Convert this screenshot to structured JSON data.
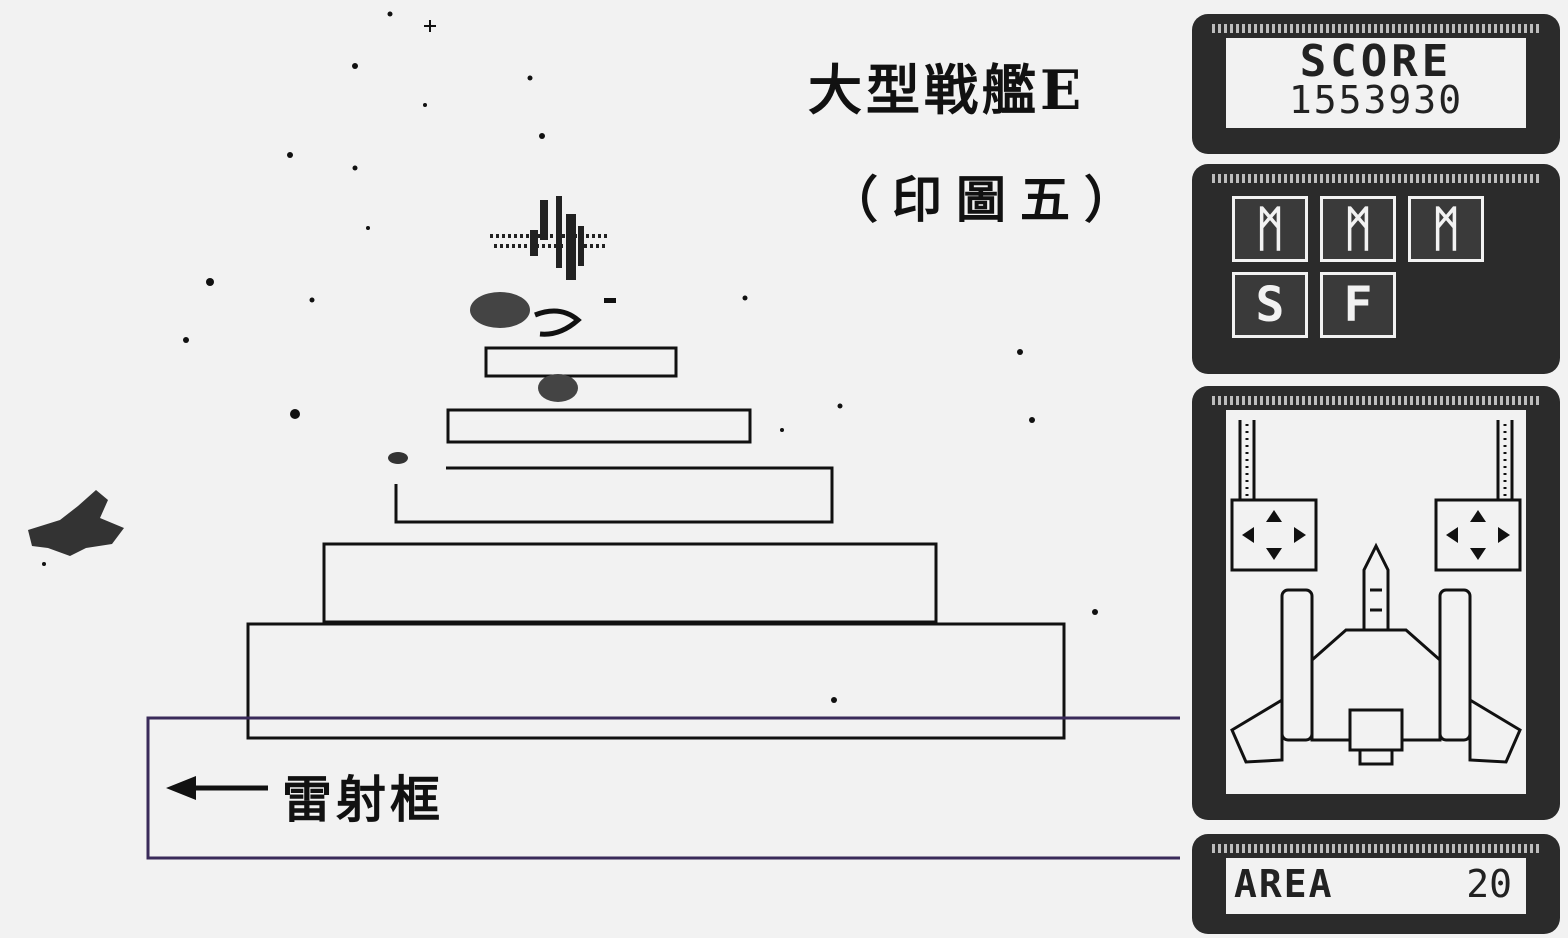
{
  "caption": {
    "title": "大型戦艦E",
    "figure": "（印圖五）",
    "laser_frame": "雷射框"
  },
  "hud": {
    "score_label": "SCORE",
    "score_value": "1553930",
    "weapons": [
      {
        "glyph": "ᛗ"
      },
      {
        "glyph": "ᛗ"
      },
      {
        "glyph": "ᛗ"
      },
      {
        "glyph": "S"
      },
      {
        "glyph": "F"
      }
    ],
    "area_label": "AREA",
    "area_value": "20"
  },
  "colors": {
    "paper": "#f2f2f2",
    "ink": "#111111",
    "panel": "#2b2b2b",
    "laser_line": "#3a2b5a"
  },
  "icons": [
    "left-arrow-icon",
    "player-ship-icon",
    "enemy-ship-icon",
    "dpad-arrow-icon"
  ]
}
